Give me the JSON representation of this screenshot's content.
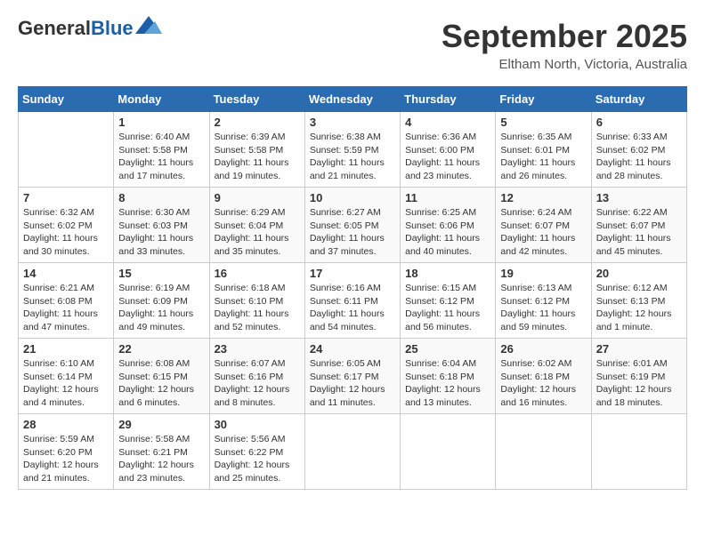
{
  "header": {
    "logo_general": "General",
    "logo_blue": "Blue",
    "month_title": "September 2025",
    "location": "Eltham North, Victoria, Australia"
  },
  "calendar": {
    "days_of_week": [
      "Sunday",
      "Monday",
      "Tuesday",
      "Wednesday",
      "Thursday",
      "Friday",
      "Saturday"
    ],
    "weeks": [
      [
        {
          "day": "",
          "content": ""
        },
        {
          "day": "1",
          "content": "Sunrise: 6:40 AM\nSunset: 5:58 PM\nDaylight: 11 hours\nand 17 minutes."
        },
        {
          "day": "2",
          "content": "Sunrise: 6:39 AM\nSunset: 5:58 PM\nDaylight: 11 hours\nand 19 minutes."
        },
        {
          "day": "3",
          "content": "Sunrise: 6:38 AM\nSunset: 5:59 PM\nDaylight: 11 hours\nand 21 minutes."
        },
        {
          "day": "4",
          "content": "Sunrise: 6:36 AM\nSunset: 6:00 PM\nDaylight: 11 hours\nand 23 minutes."
        },
        {
          "day": "5",
          "content": "Sunrise: 6:35 AM\nSunset: 6:01 PM\nDaylight: 11 hours\nand 26 minutes."
        },
        {
          "day": "6",
          "content": "Sunrise: 6:33 AM\nSunset: 6:02 PM\nDaylight: 11 hours\nand 28 minutes."
        }
      ],
      [
        {
          "day": "7",
          "content": "Sunrise: 6:32 AM\nSunset: 6:02 PM\nDaylight: 11 hours\nand 30 minutes."
        },
        {
          "day": "8",
          "content": "Sunrise: 6:30 AM\nSunset: 6:03 PM\nDaylight: 11 hours\nand 33 minutes."
        },
        {
          "day": "9",
          "content": "Sunrise: 6:29 AM\nSunset: 6:04 PM\nDaylight: 11 hours\nand 35 minutes."
        },
        {
          "day": "10",
          "content": "Sunrise: 6:27 AM\nSunset: 6:05 PM\nDaylight: 11 hours\nand 37 minutes."
        },
        {
          "day": "11",
          "content": "Sunrise: 6:25 AM\nSunset: 6:06 PM\nDaylight: 11 hours\nand 40 minutes."
        },
        {
          "day": "12",
          "content": "Sunrise: 6:24 AM\nSunset: 6:07 PM\nDaylight: 11 hours\nand 42 minutes."
        },
        {
          "day": "13",
          "content": "Sunrise: 6:22 AM\nSunset: 6:07 PM\nDaylight: 11 hours\nand 45 minutes."
        }
      ],
      [
        {
          "day": "14",
          "content": "Sunrise: 6:21 AM\nSunset: 6:08 PM\nDaylight: 11 hours\nand 47 minutes."
        },
        {
          "day": "15",
          "content": "Sunrise: 6:19 AM\nSunset: 6:09 PM\nDaylight: 11 hours\nand 49 minutes."
        },
        {
          "day": "16",
          "content": "Sunrise: 6:18 AM\nSunset: 6:10 PM\nDaylight: 11 hours\nand 52 minutes."
        },
        {
          "day": "17",
          "content": "Sunrise: 6:16 AM\nSunset: 6:11 PM\nDaylight: 11 hours\nand 54 minutes."
        },
        {
          "day": "18",
          "content": "Sunrise: 6:15 AM\nSunset: 6:12 PM\nDaylight: 11 hours\nand 56 minutes."
        },
        {
          "day": "19",
          "content": "Sunrise: 6:13 AM\nSunset: 6:12 PM\nDaylight: 11 hours\nand 59 minutes."
        },
        {
          "day": "20",
          "content": "Sunrise: 6:12 AM\nSunset: 6:13 PM\nDaylight: 12 hours\nand 1 minute."
        }
      ],
      [
        {
          "day": "21",
          "content": "Sunrise: 6:10 AM\nSunset: 6:14 PM\nDaylight: 12 hours\nand 4 minutes."
        },
        {
          "day": "22",
          "content": "Sunrise: 6:08 AM\nSunset: 6:15 PM\nDaylight: 12 hours\nand 6 minutes."
        },
        {
          "day": "23",
          "content": "Sunrise: 6:07 AM\nSunset: 6:16 PM\nDaylight: 12 hours\nand 8 minutes."
        },
        {
          "day": "24",
          "content": "Sunrise: 6:05 AM\nSunset: 6:17 PM\nDaylight: 12 hours\nand 11 minutes."
        },
        {
          "day": "25",
          "content": "Sunrise: 6:04 AM\nSunset: 6:18 PM\nDaylight: 12 hours\nand 13 minutes."
        },
        {
          "day": "26",
          "content": "Sunrise: 6:02 AM\nSunset: 6:18 PM\nDaylight: 12 hours\nand 16 minutes."
        },
        {
          "day": "27",
          "content": "Sunrise: 6:01 AM\nSunset: 6:19 PM\nDaylight: 12 hours\nand 18 minutes."
        }
      ],
      [
        {
          "day": "28",
          "content": "Sunrise: 5:59 AM\nSunset: 6:20 PM\nDaylight: 12 hours\nand 21 minutes."
        },
        {
          "day": "29",
          "content": "Sunrise: 5:58 AM\nSunset: 6:21 PM\nDaylight: 12 hours\nand 23 minutes."
        },
        {
          "day": "30",
          "content": "Sunrise: 5:56 AM\nSunset: 6:22 PM\nDaylight: 12 hours\nand 25 minutes."
        },
        {
          "day": "",
          "content": ""
        },
        {
          "day": "",
          "content": ""
        },
        {
          "day": "",
          "content": ""
        },
        {
          "day": "",
          "content": ""
        }
      ]
    ]
  }
}
